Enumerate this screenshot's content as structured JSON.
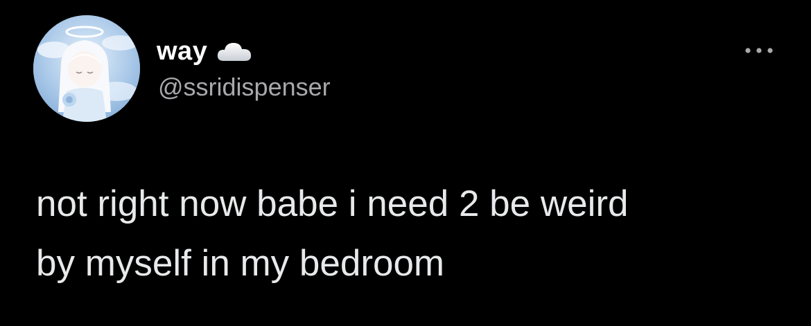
{
  "theme": {
    "background": "#000000",
    "text_color": "#e7e9ea",
    "handle_color": "#a9a9ad",
    "icon_color": "#a9a9ad"
  },
  "author": {
    "display_name": "way",
    "display_name_emoji": "cloud-icon",
    "handle": "@ssridispenser",
    "avatar": "avatar-angel-illustration"
  },
  "actions": {
    "more_icon": "more-horizontal-icon"
  },
  "tweet": {
    "text": "not right now babe i need 2 be weird\nby myself in my bedroom"
  }
}
